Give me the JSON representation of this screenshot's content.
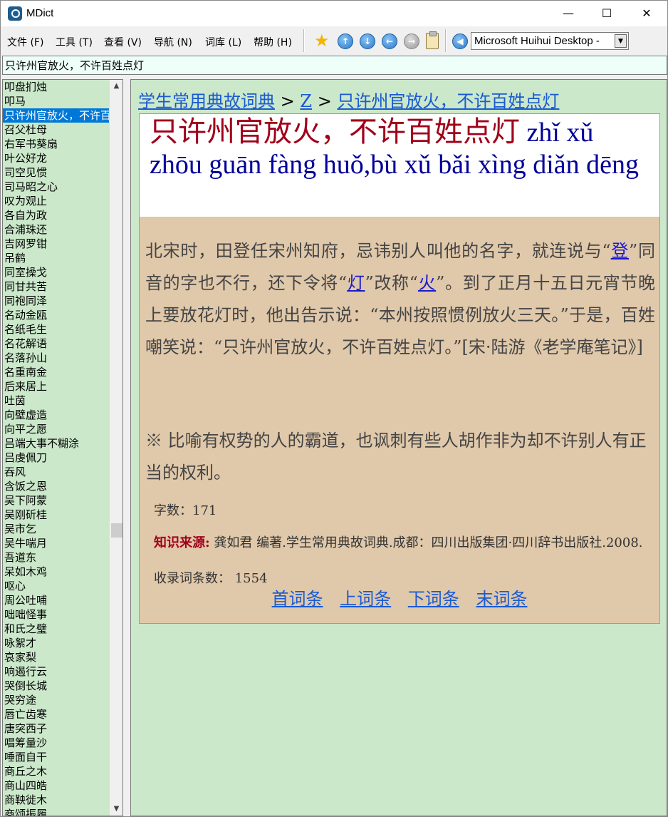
{
  "window": {
    "title": "MDict",
    "minimize": "—",
    "maximize": "☐",
    "close": "✕"
  },
  "menu": [
    "文件 (F)",
    "工具 (T)",
    "查看 (V)",
    "导航 (N)",
    "词库 (L)",
    "帮助 (H)"
  ],
  "toolbar": {
    "font_select": "Microsoft Huihui Desktop -"
  },
  "search": {
    "value": "只许州官放火，不许百姓点灯"
  },
  "word_list": [
    "叩盘扪烛",
    "叩马",
    "只许州官放火，不许百姓点灯",
    "召父杜母",
    "右军书葵扇",
    "叶公好龙",
    "司空见惯",
    "司马昭之心",
    "叹为观止",
    "各自为政",
    "合浦珠还",
    "吉网罗钳",
    "吊鹤",
    "同室操戈",
    "同甘共苦",
    "同袍同泽",
    "名动金瓯",
    "名纸毛生",
    "名花解语",
    "名落孙山",
    "名重南金",
    "后来居上",
    "吐茵",
    "向壁虚造",
    "向平之愿",
    "吕端大事不糊涂",
    "吕虔佩刀",
    "吞风",
    "含饭之恩",
    "吴下阿蒙",
    "吴刚斫桂",
    "吴市乞",
    "吴牛喘月",
    "吾道东",
    "呆如木鸡",
    "呕心",
    "周公吐哺",
    "咄咄怪事",
    "和氏之璧",
    "咏絮才",
    "哀家梨",
    "响遏行云",
    "哭倒长城",
    "哭穷途",
    "唇亡齿寒",
    "唐突西子",
    "唱筹量沙",
    "唾面自干",
    "商丘之木",
    "商山四皓",
    "商鞅徙木",
    "商颂振履"
  ],
  "selected_index": 2,
  "content": {
    "breadcrumb": {
      "dict": "学生常用典故词典",
      "sep1": " > ",
      "letter": "Z",
      "sep2": " > ",
      "entry": "只许州官放火，不许百姓点灯"
    },
    "headword_cn": "只许州官放火，不许百姓点灯",
    "headword_py": " zhǐ xǔ zhōu guān fàng huǒ,bù xǔ bǎi xìng diǎn dēng",
    "body": {
      "p1": "北宋时，田登任宋州知府，忌讳别人叫他的名字，就连说与“",
      "link1": "登",
      "p2": "”同音的字也不行，还下令将“",
      "link2": "灯",
      "p3": "”改称“",
      "link3": "火",
      "p4": "”。到了正月十五日元宵节晚上要放花灯时，他出告示说：“本州按照惯例放火三天。”于是，百姓嘲笑说：“只许州官放火，不许百姓点灯。”[宋·陆游《老学庵笔记》]"
    },
    "meaning": "※ 比喻有权势的人的霸道，也讽刺有些人胡作非为却不许别人有正当的权利。",
    "char_count": "字数：171",
    "source_label": "知识来源:",
    "source_text": " 龚如君 编著.学生常用典故词典.成都：四川出版集团·四川辞书出版社.2008.",
    "entries_count": "收录词条数： 1554",
    "nav": {
      "first": "首词条",
      "prev": "上词条",
      "next": "下词条",
      "last": "末词条"
    }
  }
}
